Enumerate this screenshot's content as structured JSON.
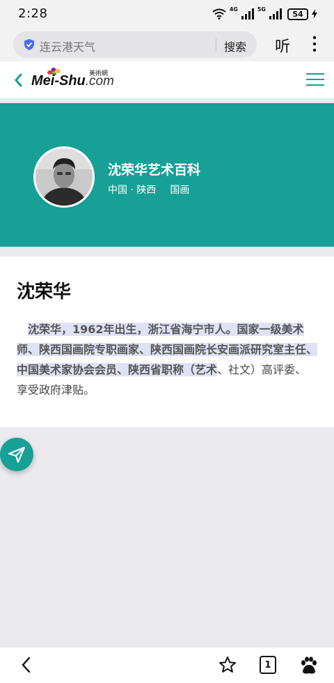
{
  "status_bar": {
    "time": "2:28",
    "net1": "4G",
    "net2": "5G",
    "battery": "54"
  },
  "browser": {
    "url_text": "连云港天气",
    "search_label": "搜索",
    "listen_label": "听"
  },
  "site": {
    "logo_text": "Mei-Shu",
    "logo_suffix": ".com",
    "logo_cn": "美術網"
  },
  "hero": {
    "title": "沈荣华艺术百科",
    "location": "中国 · 陕西",
    "category": "国画"
  },
  "article": {
    "name": "沈荣华",
    "bio_highlighted": "沈荣华，1962年出生，浙江省海宁市人。国家一级美术师、陕西国画院专职画家、陕西国画院长安画派研究室主任、中国美术家协会会员、陕西省职称（艺术",
    "bio_rest": "、社文）高评委、享受政府津贴。"
  },
  "bottom_nav": {
    "tab_count": "1"
  },
  "colors": {
    "accent": "#16a096",
    "highlight": "#dfe1f4"
  }
}
